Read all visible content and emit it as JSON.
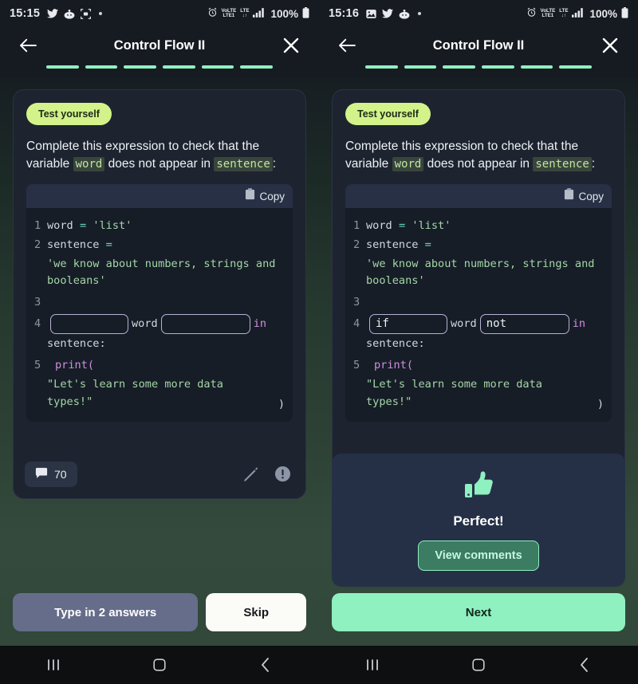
{
  "panes": [
    {
      "status_bar": {
        "time": "15:15",
        "left_icons": [
          "twitter-icon",
          "reddit-icon",
          "screenshot-icon",
          "dot-icon"
        ],
        "right_icons": [
          "alarm-icon",
          "volte-icon",
          "lte-icon",
          "signal-icon"
        ],
        "volte_label": "VoLTE",
        "volte_sub": "LTE1",
        "lte_label": "LTE",
        "battery": "100%"
      },
      "header": {
        "back_icon": "arrow-left-icon",
        "title": "Control Flow II",
        "close_icon": "close-icon",
        "progress_segments": 6,
        "progress_filled": 6
      },
      "card": {
        "badge": "Test yourself",
        "prompt_part1": "Complete this expression to check that the variable ",
        "prompt_code1": "word",
        "prompt_part2": " does not appear in ",
        "prompt_code2": "sentence",
        "prompt_part3": ":",
        "code": {
          "copy_label": "Copy",
          "copy_icon": "clipboard-icon",
          "line1_num": "1",
          "line1_var": "word",
          "line1_op": "=",
          "line1_str": "'list'",
          "line2_num": "2",
          "line2_var": "sentence",
          "line2_op": "=",
          "line2_str": "'we know about numbers, strings and booleans'",
          "line3_num": "3",
          "line4_num": "4",
          "line4_input1": "",
          "line4_mid": "word",
          "line4_input2": "",
          "line4_kw": "in",
          "line4_cont": "sentence:",
          "line5_num": "5",
          "line5_fn": "print(",
          "line5_str": "\"Let's learn some more data types!\"",
          "line5_close": ")"
        },
        "footer": {
          "comment_icon": "comment-icon",
          "comment_count": "70",
          "edit_icon": "pencil-icon",
          "report_icon": "report-icon"
        }
      },
      "actions": [
        {
          "name": "type-in-answers-button",
          "label": "Type in 2 answers",
          "style": "disabled"
        },
        {
          "name": "skip-button",
          "label": "Skip",
          "style": "light"
        }
      ],
      "nav_bar": [
        "recents-icon",
        "home-icon",
        "back-icon"
      ]
    },
    {
      "status_bar": {
        "time": "15:16",
        "left_icons": [
          "gallery-icon",
          "twitter-icon",
          "reddit-icon",
          "dot-icon"
        ],
        "right_icons": [
          "alarm-icon",
          "volte-icon",
          "lte-icon",
          "signal-icon"
        ],
        "volte_label": "VoLTE",
        "volte_sub": "LTE1",
        "lte_label": "LTE",
        "battery": "100%"
      },
      "header": {
        "back_icon": "arrow-left-icon",
        "title": "Control Flow II",
        "close_icon": "close-icon",
        "progress_segments": 6,
        "progress_filled": 6
      },
      "card": {
        "badge": "Test yourself",
        "prompt_part1": "Complete this expression to check that the variable ",
        "prompt_code1": "word",
        "prompt_part2": " does not appear in ",
        "prompt_code2": "sentence",
        "prompt_part3": ":",
        "code": {
          "copy_label": "Copy",
          "copy_icon": "clipboard-icon",
          "line1_num": "1",
          "line1_var": "word",
          "line1_op": "=",
          "line1_str": "'list'",
          "line2_num": "2",
          "line2_var": "sentence",
          "line2_op": "=",
          "line2_str": "'we know about numbers, strings and booleans'",
          "line3_num": "3",
          "line4_num": "4",
          "line4_input1": "if",
          "line4_mid": "word",
          "line4_input2": "not",
          "line4_kw": "in",
          "line4_cont": "sentence:",
          "line5_num": "5",
          "line5_fn": "print(",
          "line5_str": "\"Let's learn some more data types!\"",
          "line5_close": ")"
        },
        "footer": {
          "comment_icon": "comment-icon",
          "comment_count": "70",
          "edit_icon": "pencil-icon",
          "report_icon": "report-icon"
        }
      },
      "result_panel": {
        "icon": "thumbs-up-icon",
        "title": "Perfect!",
        "button_label": "View comments"
      },
      "actions": [
        {
          "name": "next-button",
          "label": "Next",
          "style": "primary"
        }
      ],
      "nav_bar": [
        "recents-icon",
        "home-icon",
        "back-icon"
      ]
    }
  ],
  "colors": {
    "accent_green": "#8ff0c0",
    "badge_green": "#d3f28a",
    "card_bg": "#1d2430",
    "code_bg": "#161d27",
    "panel_bg": "#253047",
    "disabled_btn": "#666d8a"
  }
}
